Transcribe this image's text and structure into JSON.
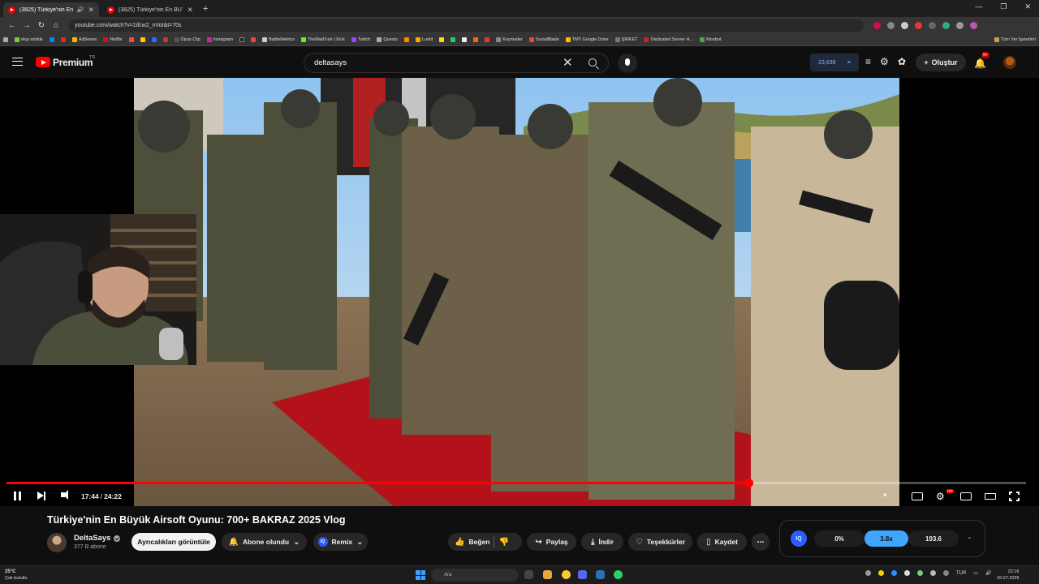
{
  "browser": {
    "tabs": [
      {
        "title": "(3825) Türkiye'nin En Büyük...",
        "active": true
      },
      {
        "title": "(3825) Türkiye'nin En BÜYÜK A...",
        "active": false
      }
    ],
    "url": "youtube.com/watch?v=1ifcw2_nVoI&t=70s",
    "bookmarks": [
      "ekşi sözlük",
      "AdSense",
      "Netflix",
      "Opus Clip",
      "Instagram",
      "BattleMetrics",
      "TheMadTurk | Kick",
      "Twitch",
      "Quests",
      "Lurkit",
      "Keymailer",
      "SocialBlade",
      "TMT Google Drive",
      "ŞİRKET",
      "Dedicated Server H...",
      "Moobot",
      "Tüm Yer İşaretleri"
    ]
  },
  "masthead": {
    "brand": "Premium",
    "region": "TR",
    "search_query": "deltasays",
    "extension_count": "23,636",
    "create_label": "Oluştur",
    "notif_badge": "9+"
  },
  "player": {
    "current_time": "17:44",
    "separator": "/",
    "duration": "24:22",
    "progress": 0.728,
    "settings_badge": "HD"
  },
  "video": {
    "title": "Türkiye'nin En Büyük Airsoft Oyunu: 700+ BAKRAZ 2025 Vlog",
    "channel": "DeltaSays",
    "subscribers": "377 B abone"
  },
  "actions": {
    "perks": "Ayrıcalıkları görüntüle",
    "subscribed": "Abone olundu",
    "remix": "Remix",
    "like": "Beğen",
    "share": "Paylaş",
    "download": "İndir",
    "thanks": "Teşekkürler",
    "save": "Kaydet",
    "more": "⋯"
  },
  "iq_panel": {
    "logo": "IQ",
    "stat1": "0%",
    "stat2": "3.8x",
    "stat3": "193.6"
  },
  "taskbar": {
    "temperature": "25°C",
    "weather": "Çok bulutlu",
    "search_placeholder": "Ara",
    "language": "TUR",
    "time": "22:16",
    "date": "16.07.2025"
  }
}
